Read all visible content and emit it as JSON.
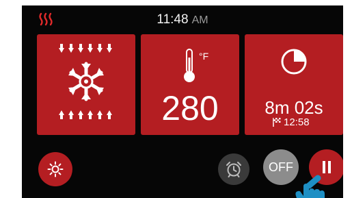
{
  "header": {
    "time": "11:48",
    "ampm": "AM",
    "heat_icon": "heat-waves-icon"
  },
  "tiles": {
    "mode": {
      "icon": "convection-fan-snowflake-icon"
    },
    "temperature": {
      "unit": "°F",
      "value": "280",
      "icon": "thermometer-icon"
    },
    "timer": {
      "remaining": "8m 02s",
      "end_time": "12:58",
      "icon": "clock-pie-icon",
      "end_icon": "checkered-flag-icon"
    }
  },
  "controls": {
    "light_icon": "sun-icon",
    "alarm_icon": "alarm-clock-icon",
    "off_label": "OFF",
    "pause_icon": "pause-icon"
  },
  "colors": {
    "screen_bg": "#060606",
    "accent_red": "#b41e22",
    "off_gray": "#8c8c8c",
    "alarm_gray": "#3a3a3a",
    "touch_blue": "#1e8fc4"
  }
}
